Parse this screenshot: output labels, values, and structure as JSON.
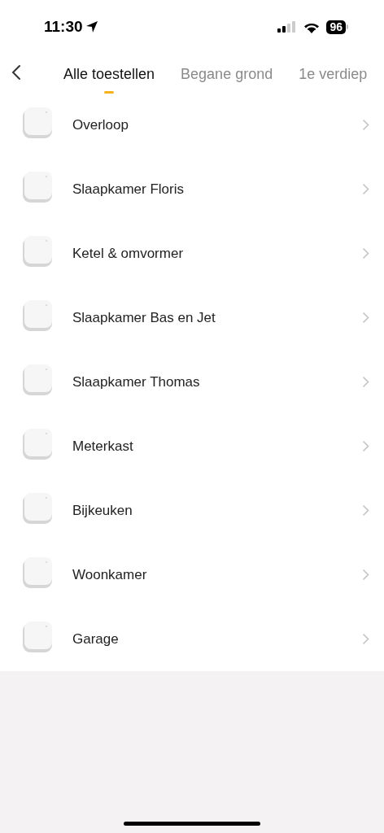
{
  "status_bar": {
    "time": "11:30",
    "battery": "96"
  },
  "tabs": [
    {
      "label": "Alle toestellen",
      "selected": true
    },
    {
      "label": "Begane grond",
      "selected": false
    },
    {
      "label": "1e verdiep",
      "selected": false
    }
  ],
  "devices": [
    {
      "name": "Overloop"
    },
    {
      "name": "Slaapkamer Floris"
    },
    {
      "name": "Ketel & omvormer"
    },
    {
      "name": "Slaapkamer Bas en Jet"
    },
    {
      "name": "Slaapkamer Thomas"
    },
    {
      "name": "Meterkast"
    },
    {
      "name": "Bijkeuken"
    },
    {
      "name": "Woonkamer"
    },
    {
      "name": "Garage"
    }
  ]
}
